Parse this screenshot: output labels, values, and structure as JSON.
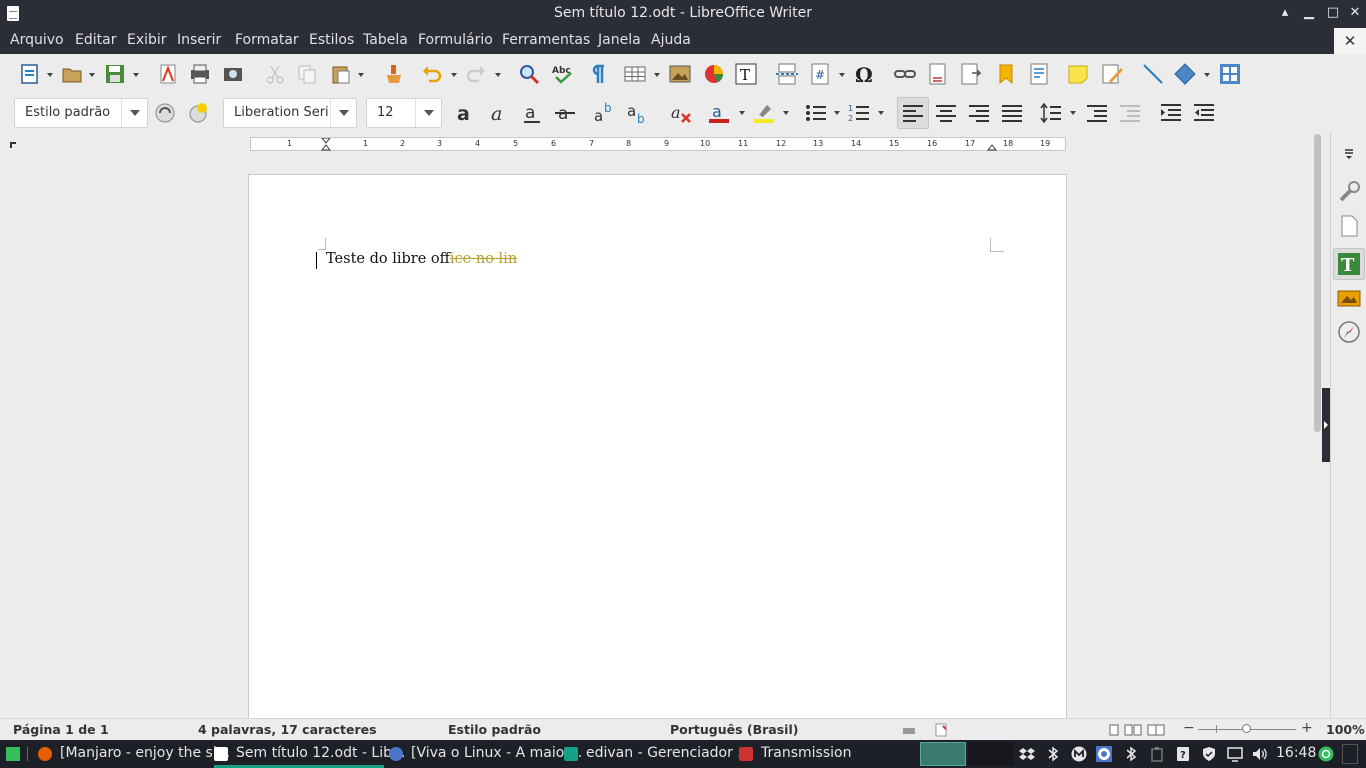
{
  "window": {
    "title": "Sem título 12.odt - LibreOffice Writer",
    "minimize_icon": "minimize-icon",
    "maximize_icon": "maximize-icon",
    "close_icon": "close-icon"
  },
  "menu": {
    "items": [
      "Arquivo",
      "Editar",
      "Exibir",
      "Inserir",
      "Formatar",
      "Estilos",
      "Tabela",
      "Formulário",
      "Ferramentas",
      "Janela",
      "Ajuda"
    ],
    "close_doc": "✕"
  },
  "toolbar_standard": {
    "icons": [
      "new-document-icon",
      "open-icon",
      "save-icon",
      "export-pdf-icon",
      "print-icon",
      "print-preview-icon",
      "cut-icon",
      "copy-icon",
      "paste-icon",
      "clone-formatting-icon",
      "undo-icon",
      "redo-icon",
      "find-replace-icon",
      "spelling-icon",
      "formatting-marks-icon",
      "insert-table-icon",
      "insert-image-icon",
      "insert-chart-icon",
      "insert-textbox-icon",
      "page-break-icon",
      "insert-field-icon",
      "special-character-icon",
      "hyperlink-icon",
      "footnote-icon",
      "endnote-icon",
      "bookmark-icon",
      "cross-reference-icon",
      "comment-icon",
      "track-changes-icon",
      "line-icon",
      "basic-shapes-icon",
      "show-draw-functions-icon"
    ]
  },
  "toolbar_formatting": {
    "paragraph_style": "Estilo padrão",
    "font_name": "Liberation Seri",
    "font_size": "12",
    "icons": [
      "update-style-icon",
      "new-style-icon",
      "bold-icon",
      "italic-icon",
      "underline-icon",
      "strikethrough-icon",
      "superscript-icon",
      "subscript-icon",
      "clear-formatting-icon",
      "font-color-icon",
      "highlight-color-icon",
      "unordered-list-icon",
      "ordered-list-icon",
      "align-left-icon",
      "align-center-icon",
      "align-right-icon",
      "justify-icon",
      "line-spacing-icon",
      "increase-paragraph-spacing-icon",
      "decrease-paragraph-spacing-icon",
      "increase-indent-icon",
      "decrease-indent-icon"
    ]
  },
  "ruler": {
    "ticks": [
      "1",
      "1",
      "2",
      "3",
      "4",
      "5",
      "6",
      "7",
      "8",
      "9",
      "10",
      "11",
      "12",
      "13",
      "14",
      "15",
      "16",
      "17",
      "18",
      "19"
    ]
  },
  "document": {
    "text_normal": "Teste do libre of",
    "text_tracked": "fice no lin"
  },
  "sidebar": {
    "icons": [
      "sidebar-menu-icon",
      "properties-icon",
      "page-icon",
      "styles-icon",
      "gallery-icon",
      "navigator-icon"
    ]
  },
  "statusbar": {
    "page": "Página 1 de 1",
    "word_count": "4 palavras, 17 caracteres",
    "style": "Estilo padrão",
    "language": "Português (Brasil)",
    "zoom": "100%"
  },
  "taskbar": {
    "tasks": [
      {
        "label": "[Manjaro - enjoy the si...",
        "icon": "firefox-icon"
      },
      {
        "label": "Sem título 12.odt - Lib...",
        "icon": "writer-icon"
      },
      {
        "label": "[Viva o Linux - A maior...",
        "icon": "chromium-icon"
      },
      {
        "label": "edivan - Gerenciador ...",
        "icon": "file-manager-icon"
      },
      {
        "label": "Transmission",
        "icon": "transmission-icon"
      }
    ],
    "clock": "16:48"
  },
  "colors": {
    "dark_bar": "#2b2e37",
    "taskbar": "#1d2027",
    "accent": "#16a085",
    "tracked_text": "#b8a030"
  }
}
